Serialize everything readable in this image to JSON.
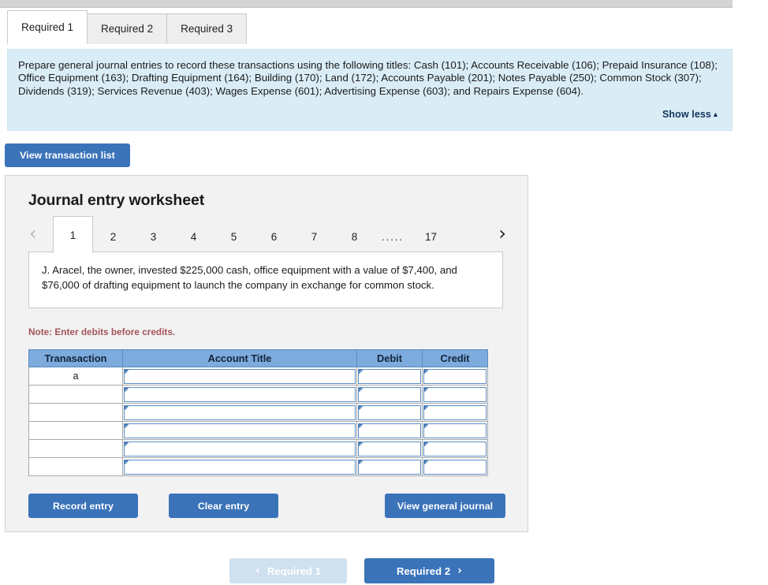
{
  "tabs": [
    {
      "label": "Required 1",
      "active": true
    },
    {
      "label": "Required 2",
      "active": false
    },
    {
      "label": "Required 3",
      "active": false
    }
  ],
  "instructions": {
    "text": "Prepare general journal entries to record these transactions using the following titles: Cash (101); Accounts Receivable (106); Prepaid Insurance (108); Office Equipment (163); Drafting Equipment (164); Building (170); Land (172); Accounts Payable (201); Notes Payable (250); Common Stock (307); Dividends (319); Services Revenue (403); Wages Expense (601); Advertising Expense (603); and Repairs Expense (604).",
    "show_less_label": "Show less",
    "show_less_caret": "▲",
    "background_color": "#daedf7"
  },
  "toolbar": {
    "view_transaction_list_label": "View transaction list"
  },
  "worksheet": {
    "title": "Journal entry worksheet",
    "pager": {
      "prev_arrow": "‹",
      "next_arrow": "›",
      "pages": [
        "1",
        "2",
        "3",
        "4",
        "5",
        "6",
        "7",
        "8"
      ],
      "ellipsis": ".....",
      "last_page": "17",
      "active_page": "1"
    },
    "transaction_text": "J. Aracel, the owner, invested $225,000 cash, office equipment with a value of $7,400, and $76,000 of drafting equipment to launch the company in exchange for common stock.",
    "note": "Note: Enter debits before credits.",
    "table": {
      "headers": [
        "Tranasaction",
        "Account Title",
        "Debit",
        "Credit"
      ],
      "rows": [
        {
          "transaction": "a",
          "account_title": "",
          "debit": "",
          "credit": ""
        },
        {
          "transaction": "",
          "account_title": "",
          "debit": "",
          "credit": ""
        },
        {
          "transaction": "",
          "account_title": "",
          "debit": "",
          "credit": ""
        },
        {
          "transaction": "",
          "account_title": "",
          "debit": "",
          "credit": ""
        },
        {
          "transaction": "",
          "account_title": "",
          "debit": "",
          "credit": ""
        },
        {
          "transaction": "",
          "account_title": "",
          "debit": "",
          "credit": ""
        }
      ],
      "header_color": "#7dabdd"
    },
    "actions": {
      "record_entry_label": "Record entry",
      "clear_entry_label": "Clear entry",
      "view_general_journal_label": "View general journal"
    }
  },
  "bottom_nav": {
    "prev_label": "Required 1",
    "prev_chevron": "‹",
    "prev_disabled": true,
    "next_label": "Required 2",
    "next_chevron": "›"
  },
  "colors": {
    "accent_blue": "#3b73b9",
    "panel_blue": "#daedf7",
    "table_header_blue": "#7dabdd",
    "note_red": "#a4545b",
    "disabled_blue": "#cfe0ef"
  }
}
